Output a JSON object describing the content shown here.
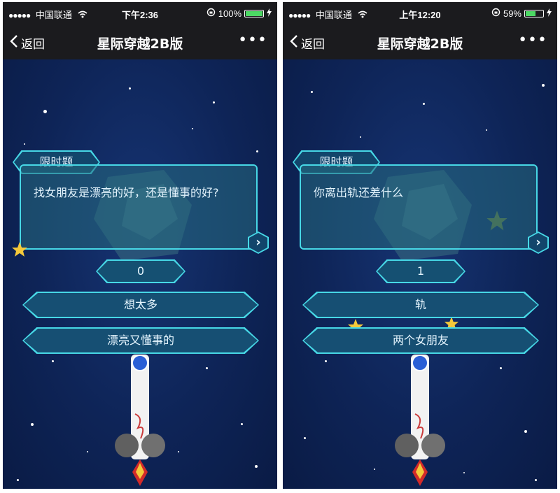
{
  "left": {
    "status": {
      "signal": "●●●●●",
      "carrier": "中国联通",
      "time": "下午2:36",
      "battery": "100%",
      "battery_level": 1.0
    },
    "nav": {
      "back_label": "返回",
      "title": "星际穿越2B版",
      "more": "•••"
    },
    "game": {
      "tag": "限时题",
      "question": "找女朋友是漂亮的好，还是懂事的好?",
      "next": "›",
      "score": "0",
      "options": [
        "想太多",
        "漂亮又懂事的"
      ]
    }
  },
  "right": {
    "status": {
      "signal": "●●●●●",
      "carrier": "中国联通",
      "time": "上午12:20",
      "battery": "59%",
      "battery_level": 0.59
    },
    "nav": {
      "back_label": "返回",
      "title": "星际穿越2B版",
      "more": "•••"
    },
    "game": {
      "tag": "限时题",
      "question": "你离出轨还差什么",
      "next": "›",
      "score": "1",
      "options": [
        "轨",
        "两个女朋友"
      ]
    }
  },
  "colors": {
    "accent": "#47d8e6",
    "background": "#0e2457",
    "bar": "#1b1b1e",
    "battery_green": "#4cd964",
    "star_yellow": "#f5c93a"
  },
  "icons": [
    "back-chevron-icon",
    "wifi-icon",
    "lock-rotation-icon",
    "battery-icon",
    "charging-icon",
    "more-icon",
    "next-arrow-icon",
    "star-icon",
    "rocket-icon",
    "planet-icon"
  ]
}
